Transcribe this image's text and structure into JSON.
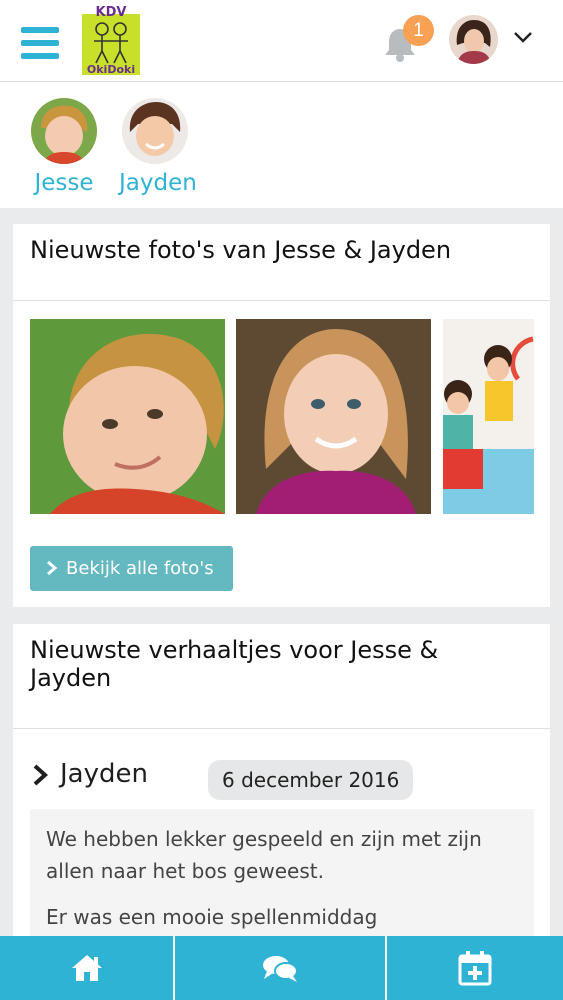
{
  "header": {
    "logo": {
      "top_text": "KDV",
      "bottom_text": "OkiDoki"
    },
    "notifications": {
      "count": "1"
    },
    "icons": [
      "menu-icon",
      "bell-icon",
      "chevron-down-icon"
    ]
  },
  "children": [
    {
      "name": "Jesse"
    },
    {
      "name": "Jayden"
    }
  ],
  "photos_card": {
    "title": "Nieuwste foto's van Jesse & Jayden",
    "button_label": "Bekijk alle foto's"
  },
  "stories_card": {
    "title": "Nieuwste verhaaltjes voor Jesse & Jayden",
    "story": {
      "child": "Jayden",
      "date": "6 december 2016",
      "paragraphs": [
        "We hebben lekker gespeeld en zijn met zijn allen naar het bos geweest.",
        "Er was een mooie spellenmiddag"
      ]
    }
  },
  "bottom_nav": {
    "items": [
      "home-icon",
      "chat-icon",
      "calendar-add-icon"
    ]
  },
  "colors": {
    "accent": "#2fb3d4",
    "button": "#64b8c0",
    "badge": "#f7a154",
    "logo_bg": "#c9e02b",
    "logo_text": "#6b2c91"
  }
}
